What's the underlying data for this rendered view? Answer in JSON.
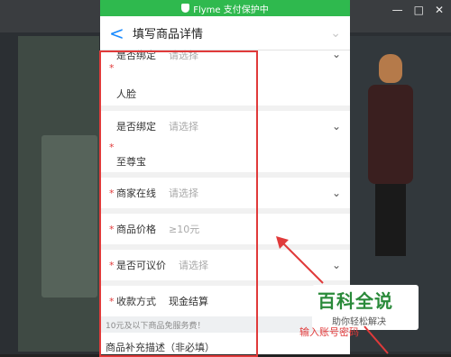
{
  "window": {
    "controls": [
      "—",
      "□",
      "✕"
    ]
  },
  "status_bar": {
    "text": "Flyme 支付保护中"
  },
  "header": {
    "back_symbol": "<",
    "title": "填写商品详情"
  },
  "form": {
    "rows": [
      {
        "label": "是否绑定",
        "placeholder": "请选择",
        "value": "人脸",
        "required": true
      },
      {
        "label": "是否绑定",
        "placeholder": "请选择",
        "value": "至尊宝",
        "required": true
      },
      {
        "label": "商家在线",
        "placeholder": "请选择",
        "required": true
      },
      {
        "label": "商品价格",
        "placeholder": "≥10元",
        "required": true
      },
      {
        "label": "是否可议价",
        "placeholder": "请选择",
        "required": true
      },
      {
        "label": "收款方式",
        "value": "现金结算",
        "required": true
      }
    ],
    "required_mark": "*",
    "note": "10元及以下商品免服务费！",
    "description_label": "商品补充描述（非必填）"
  },
  "watermark": {
    "title": "百科全说",
    "subtitle": "助你轻松解决"
  },
  "annotation": {
    "text": "输入账号密码"
  },
  "colors": {
    "status": "#2fb94e",
    "accent": "#1a8bff",
    "required": "#e03a3a"
  }
}
